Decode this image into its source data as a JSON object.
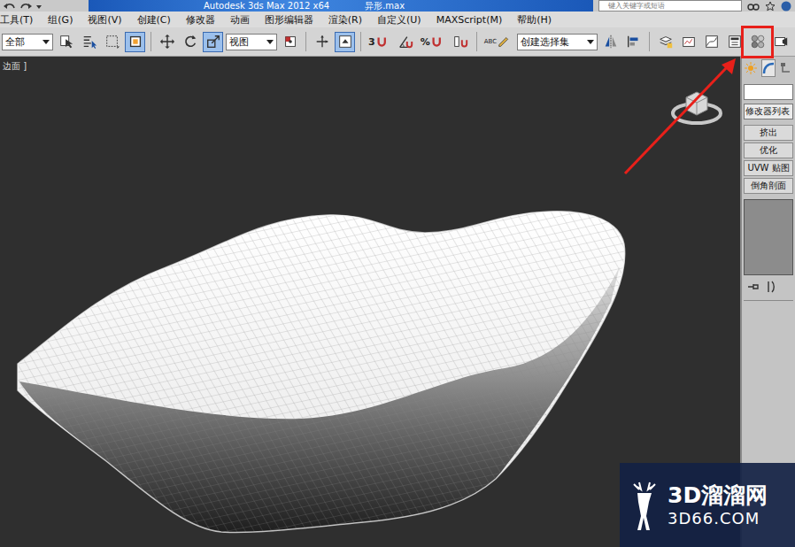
{
  "window": {
    "title": "Autodesk 3ds Max  2012 x64",
    "file": "异形.max"
  },
  "search": {
    "placeholder": "键入关键字或短语"
  },
  "menu": [
    "工具(T)",
    "组(G)",
    "视图(V)",
    "创建(C)",
    "修改器",
    "动画",
    "图形编辑器",
    "渲染(R)",
    "自定义(U)",
    "MAXScript(M)",
    "帮助(H)"
  ],
  "toolbar": [
    {
      "kind": "dropdown",
      "label": "全部"
    },
    {
      "kind": "button",
      "selected": false,
      "annotated": false
    },
    {
      "kind": "button",
      "selected": false,
      "annotated": false
    },
    {
      "kind": "button",
      "selected": false,
      "annotated": false
    },
    {
      "kind": "button",
      "selected": true,
      "annotated": false
    },
    {
      "kind": "sep"
    },
    {
      "kind": "button",
      "selected": false,
      "annotated": false
    },
    {
      "kind": "button",
      "selected": false,
      "annotated": false
    },
    {
      "kind": "button",
      "selected": true,
      "annotated": false
    },
    {
      "kind": "dropdown",
      "label": "视图"
    },
    {
      "kind": "button",
      "selected": false,
      "annotated": false
    },
    {
      "kind": "sep"
    },
    {
      "kind": "button",
      "selected": false,
      "annotated": false
    },
    {
      "kind": "button",
      "selected": true,
      "annotated": false
    },
    {
      "kind": "sep"
    },
    {
      "kind": "button",
      "label": "3",
      "selected": false,
      "annotated": false
    },
    {
      "kind": "button",
      "selected": false,
      "annotated": false
    },
    {
      "kind": "button",
      "label": "%",
      "selected": false,
      "annotated": false
    },
    {
      "kind": "button",
      "selected": false,
      "annotated": false
    },
    {
      "kind": "sep"
    },
    {
      "kind": "button",
      "label": "ABC",
      "selected": false,
      "annotated": false
    },
    {
      "kind": "dropdown",
      "label": "创建选择集"
    },
    {
      "kind": "button",
      "selected": false,
      "annotated": false
    },
    {
      "kind": "button",
      "selected": false,
      "annotated": false
    },
    {
      "kind": "sep"
    },
    {
      "kind": "button",
      "selected": false,
      "annotated": false
    },
    {
      "kind": "button",
      "selected": false,
      "annotated": false
    },
    {
      "kind": "button",
      "selected": false,
      "annotated": false
    },
    {
      "kind": "button",
      "selected": false,
      "annotated": false
    },
    {
      "kind": "button",
      "selected": false,
      "annotated": true
    },
    {
      "kind": "button",
      "selected": false,
      "annotated": false
    }
  ],
  "viewport": {
    "label": "边面 ]"
  },
  "command_panel": {
    "tabs": [
      {
        "selected": false
      },
      {
        "selected": true
      },
      {
        "selected": false
      }
    ],
    "modifier_list": "修改器列表",
    "buttons": [
      "挤出",
      "优化",
      "UVW 贴图",
      "倒角剖面"
    ]
  },
  "watermark": {
    "brand": "3D溜溜网",
    "site": "3D66.COM"
  }
}
